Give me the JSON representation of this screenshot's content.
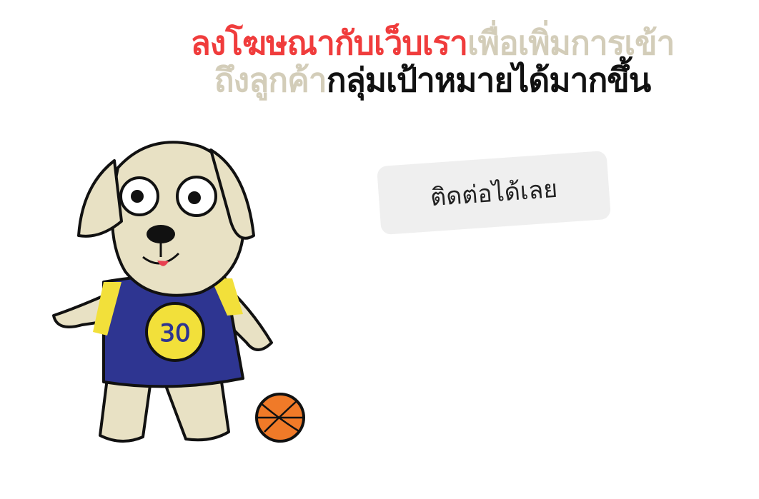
{
  "headline": {
    "line1_part1": "ลงโฆษณากับเว็บเรา",
    "line1_part2": "เพื่อเพิ่มการเข้า",
    "line2_part1": "ถึงลูกค้า",
    "line2_part2": "กลุ่มเป้าหมายได้มากขึ้น"
  },
  "cta": {
    "label": "ติดต่อได้เลย"
  },
  "mascot": {
    "jersey_number": "30"
  },
  "colors": {
    "accent_red": "#f03c3c",
    "beige": "#d3cdb9",
    "jersey": "#2e3591",
    "jersey_trim": "#f2e03a",
    "ball": "#f07a28"
  }
}
